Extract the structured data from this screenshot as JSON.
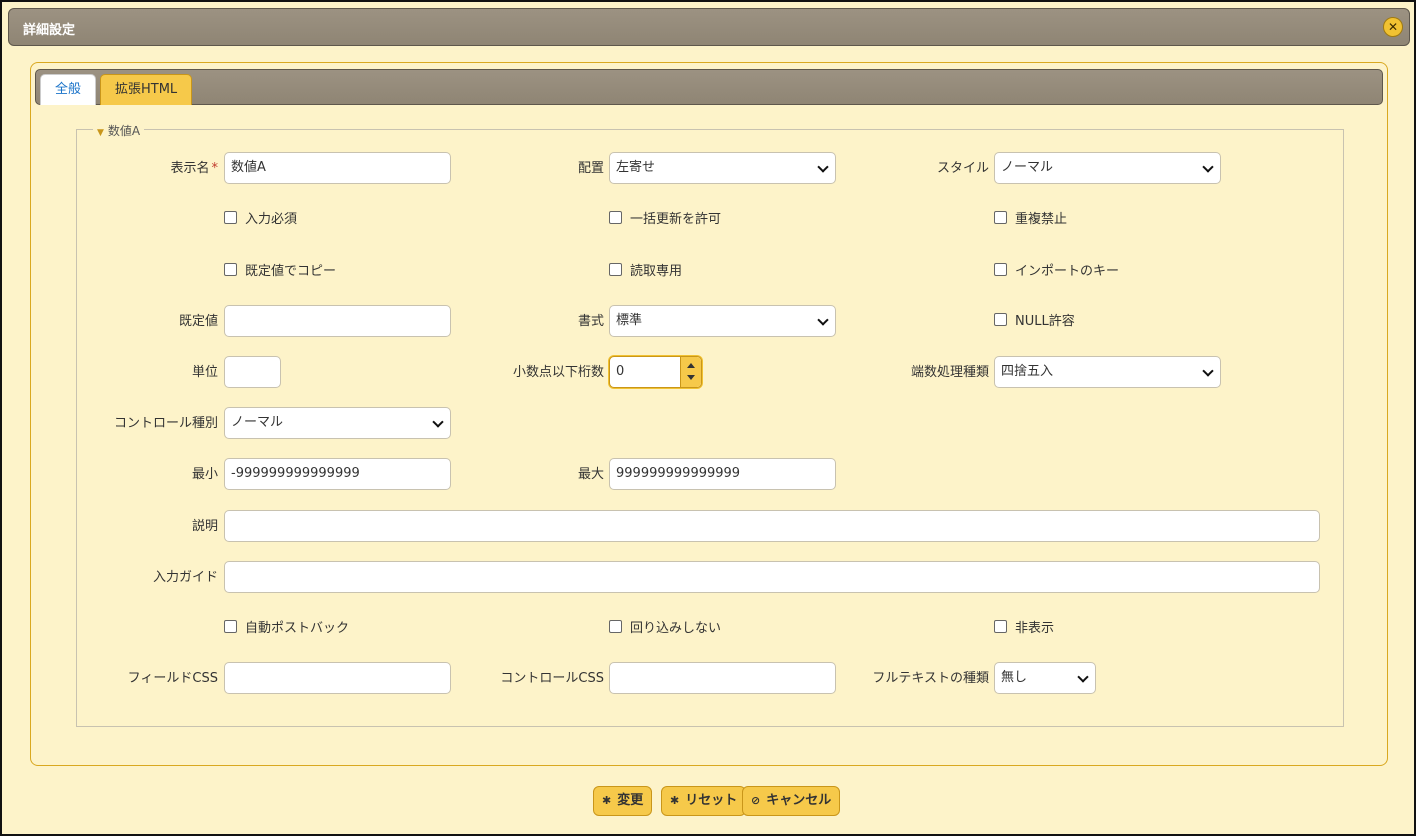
{
  "window": {
    "title": "詳細設定"
  },
  "tabs": [
    {
      "label": "全般"
    },
    {
      "label": "拡張HTML"
    }
  ],
  "section": {
    "title": "数値A"
  },
  "fields": {
    "display_name": {
      "label": "表示名",
      "required_mark": "*",
      "value": "数値A"
    },
    "alignment": {
      "label": "配置",
      "value": "左寄せ"
    },
    "style": {
      "label": "スタイル",
      "value": "ノーマル"
    },
    "default_value": {
      "label": "既定値",
      "value": ""
    },
    "format": {
      "label": "書式",
      "value": "標準"
    },
    "unit": {
      "label": "単位",
      "value": ""
    },
    "decimals": {
      "label": "小数点以下桁数",
      "value": "0"
    },
    "rounding": {
      "label": "端数処理種類",
      "value": "四捨五入"
    },
    "control_type": {
      "label": "コントロール種別",
      "value": "ノーマル"
    },
    "min": {
      "label": "最小",
      "value": "-999999999999999"
    },
    "max": {
      "label": "最大",
      "value": "999999999999999"
    },
    "description": {
      "label": "説明",
      "value": ""
    },
    "input_guide": {
      "label": "入力ガイド",
      "value": ""
    },
    "field_css": {
      "label": "フィールドCSS",
      "value": ""
    },
    "control_css": {
      "label": "コントロールCSS",
      "value": ""
    },
    "fulltext": {
      "label": "フルテキストの種類",
      "value": "無し"
    }
  },
  "checkboxes": {
    "required": {
      "label": "入力必須",
      "checked": false
    },
    "bulk_update": {
      "label": "一括更新を許可",
      "checked": false
    },
    "no_duplicate": {
      "label": "重複禁止",
      "checked": false
    },
    "copy_default": {
      "label": "既定値でコピー",
      "checked": false
    },
    "read_only": {
      "label": "読取専用",
      "checked": false
    },
    "import_key": {
      "label": "インポートのキー",
      "checked": false
    },
    "allow_null": {
      "label": "NULL許容",
      "checked": false
    },
    "auto_postback": {
      "label": "自動ポストバック",
      "checked": false
    },
    "no_wrap": {
      "label": "回り込みしない",
      "checked": false
    },
    "hidden": {
      "label": "非表示",
      "checked": false
    }
  },
  "buttons": {
    "change": "変更",
    "reset": "リセット",
    "cancel": "キャンセル"
  },
  "icons": {
    "close": "close-icon",
    "dropdown": "chevron-down-icon",
    "button": "gear-icon",
    "cancel": "cancel-icon"
  },
  "colors": {
    "background": "#fdf3c9",
    "titlebar": "#968c7b",
    "accent": "#f6c94a",
    "tab_active_text": "#1a73c9",
    "required": "#c0392b"
  }
}
